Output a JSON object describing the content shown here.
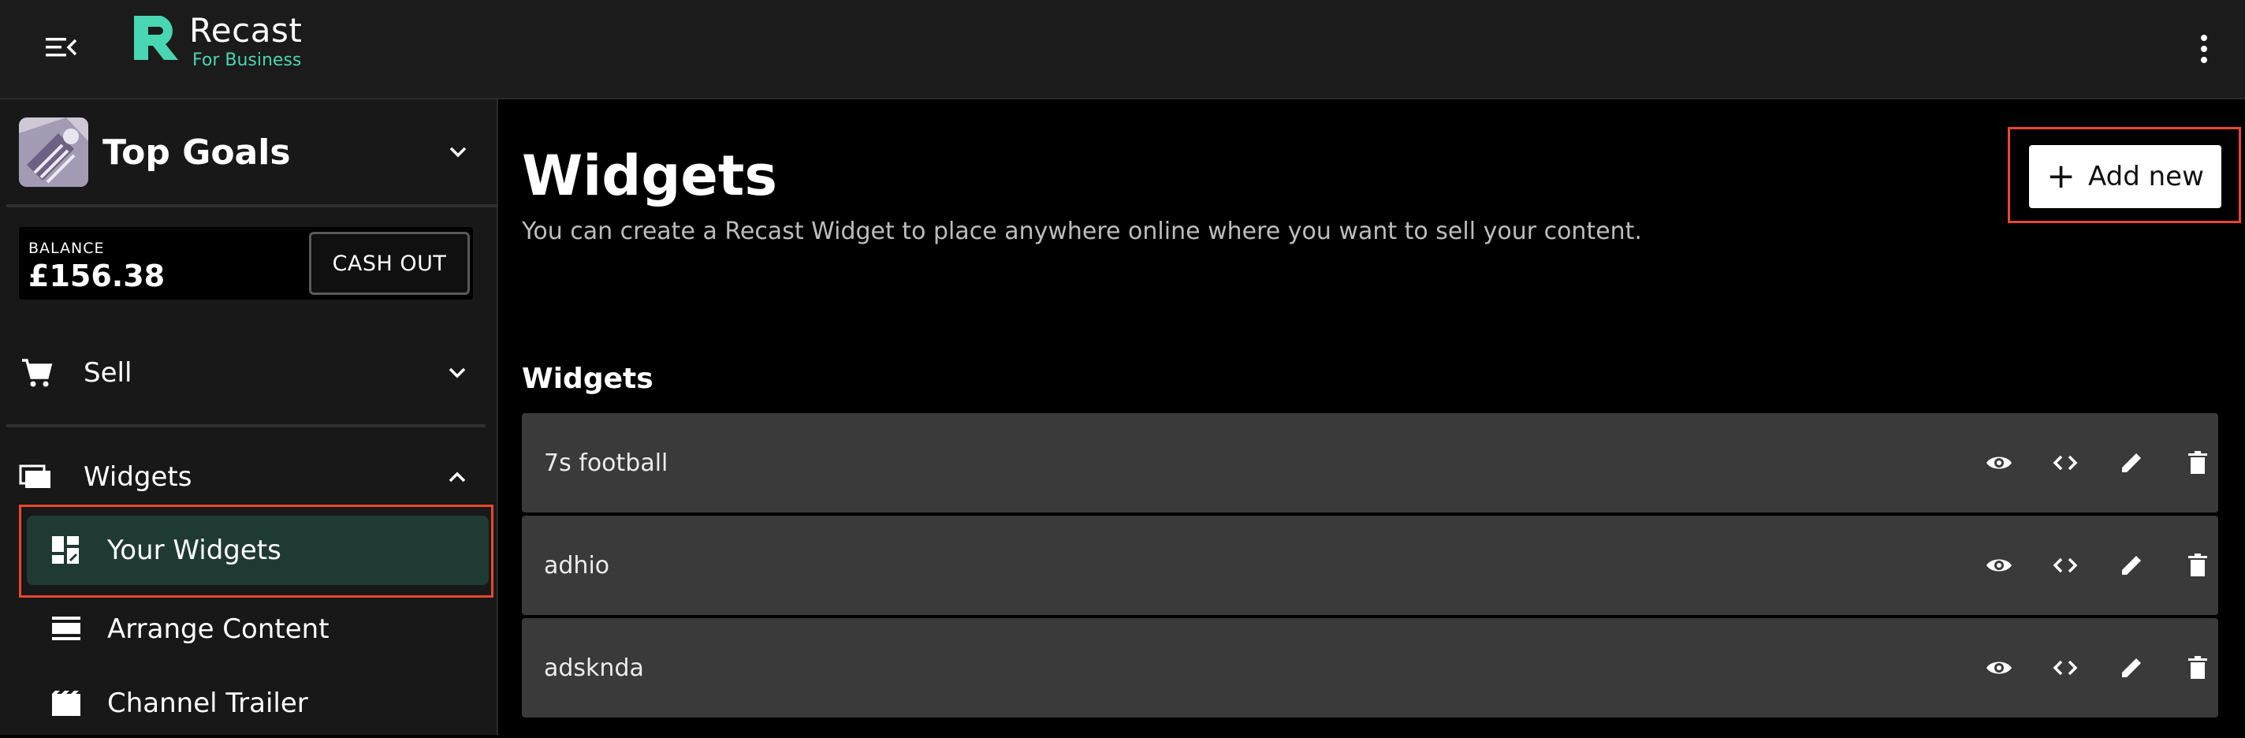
{
  "brand": {
    "name": "Recast",
    "subtitle": "For Business"
  },
  "sidebar": {
    "channel_name": "Top Goals",
    "balance_label": "BALANCE",
    "balance_value": "£156.38",
    "cashout_label": "CASH OUT",
    "sections": [
      {
        "label": "Sell",
        "icon": "cart-icon"
      },
      {
        "label": "Widgets",
        "icon": "widgets-icon"
      }
    ],
    "sub_items": [
      {
        "label": "Your Widgets",
        "icon": "dashboard-icon",
        "active": true
      },
      {
        "label": "Arrange Content",
        "icon": "arrange-icon"
      },
      {
        "label": "Channel Trailer",
        "icon": "clapperboard-icon"
      }
    ]
  },
  "main": {
    "title": "Widgets",
    "description": "You can create a Recast Widget to place anywhere online where you want to sell your content.",
    "add_button": "Add new",
    "list_title": "Widgets",
    "widgets": [
      "7s football",
      "adhio",
      "adsknda"
    ]
  },
  "colors": {
    "accent": "#49d6b2",
    "highlight": "#e8472f",
    "row_bg": "#3a3a3a",
    "active_bg": "#1f3a33"
  }
}
